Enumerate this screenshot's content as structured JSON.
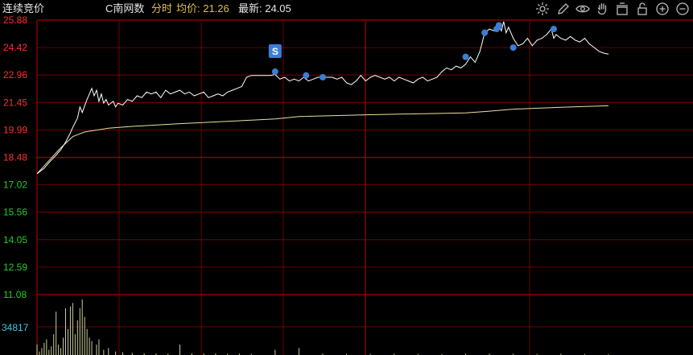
{
  "header": {
    "title": "连续竞价",
    "stock_name": "C南网数",
    "mode": "分时",
    "avg_label": "均价: 21.26",
    "latest_label": "最新: 24.05"
  },
  "toolbar": {
    "icons": [
      "gear-icon",
      "pen-icon",
      "eye-icon",
      "hand-icon",
      "basket-icon",
      "lock-icon",
      "zoom-in-icon",
      "zoom-out-icon"
    ]
  },
  "colors": {
    "price_line": "#ffffff",
    "avg_line": "#e8e2a0",
    "grid_red": "#8b0000",
    "axis_up": "#ff3030",
    "axis_down": "#22cc22",
    "volume": "#cccc99",
    "marker": "#3a7fd5",
    "badge_bg": "#3a7fd5"
  },
  "signal_badge": "S",
  "volume_label": "34817",
  "chart_data": {
    "type": "line",
    "y_ticks": [
      "25.88",
      "24.42",
      "22.96",
      "21.45",
      "19.99",
      "18.48",
      "17.02",
      "15.56",
      "14.05",
      "12.59",
      "11.08"
    ],
    "ylim": [
      11.08,
      25.88
    ],
    "x_range": [
      0,
      240
    ],
    "price": [
      [
        0,
        17.6
      ],
      [
        3,
        17.9
      ],
      [
        5,
        18.2
      ],
      [
        8,
        18.6
      ],
      [
        10,
        18.9
      ],
      [
        12,
        19.3
      ],
      [
        14,
        19.8
      ],
      [
        15,
        20.1
      ],
      [
        17,
        20.6
      ],
      [
        18,
        21.2
      ],
      [
        19,
        20.9
      ],
      [
        21,
        21.6
      ],
      [
        22,
        21.9
      ],
      [
        23,
        22.2
      ],
      [
        24,
        21.8
      ],
      [
        25,
        22.1
      ],
      [
        26,
        21.5
      ],
      [
        27,
        21.9
      ],
      [
        28,
        21.4
      ],
      [
        29,
        21.6
      ],
      [
        30,
        21.3
      ],
      [
        32,
        21.5
      ],
      [
        33,
        21.2
      ],
      [
        34,
        21.4
      ],
      [
        36,
        21.3
      ],
      [
        38,
        21.6
      ],
      [
        40,
        21.5
      ],
      [
        42,
        21.8
      ],
      [
        44,
        21.7
      ],
      [
        46,
        22.0
      ],
      [
        48,
        21.9
      ],
      [
        50,
        22.0
      ],
      [
        52,
        21.7
      ],
      [
        54,
        22.1
      ],
      [
        56,
        21.9
      ],
      [
        58,
        22.0
      ],
      [
        60,
        22.1
      ],
      [
        62,
        21.9
      ],
      [
        64,
        22.0
      ],
      [
        66,
        21.8
      ],
      [
        68,
        21.9
      ],
      [
        70,
        22.0
      ],
      [
        72,
        21.7
      ],
      [
        74,
        21.8
      ],
      [
        76,
        21.9
      ],
      [
        78,
        21.8
      ],
      [
        80,
        22.0
      ],
      [
        82,
        22.1
      ],
      [
        84,
        22.2
      ],
      [
        86,
        22.3
      ],
      [
        88,
        22.8
      ],
      [
        90,
        22.9
      ],
      [
        92,
        22.9
      ],
      [
        94,
        22.9
      ],
      [
        96,
        22.9
      ],
      [
        98,
        22.9
      ],
      [
        100,
        22.95
      ],
      [
        102,
        22.7
      ],
      [
        104,
        22.8
      ],
      [
        106,
        22.6
      ],
      [
        108,
        22.7
      ],
      [
        110,
        22.6
      ],
      [
        112,
        22.8
      ],
      [
        114,
        22.6
      ],
      [
        116,
        22.7
      ],
      [
        118,
        22.8
      ],
      [
        120,
        22.8
      ],
      [
        122,
        22.8
      ],
      [
        124,
        22.8
      ],
      [
        126,
        22.7
      ],
      [
        128,
        22.8
      ],
      [
        130,
        22.5
      ],
      [
        132,
        22.4
      ],
      [
        134,
        22.6
      ],
      [
        136,
        22.9
      ],
      [
        138,
        22.6
      ],
      [
        140,
        22.8
      ],
      [
        142,
        22.9
      ],
      [
        144,
        22.8
      ],
      [
        146,
        22.7
      ],
      [
        148,
        22.8
      ],
      [
        150,
        22.6
      ],
      [
        152,
        22.8
      ],
      [
        154,
        22.7
      ],
      [
        156,
        22.6
      ],
      [
        158,
        22.5
      ],
      [
        160,
        22.7
      ],
      [
        162,
        22.8
      ],
      [
        164,
        22.6
      ],
      [
        166,
        22.7
      ],
      [
        168,
        22.8
      ],
      [
        170,
        23.1
      ],
      [
        172,
        23.3
      ],
      [
        174,
        23.2
      ],
      [
        176,
        23.4
      ],
      [
        178,
        23.3
      ],
      [
        180,
        23.5
      ],
      [
        182,
        23.9
      ],
      [
        184,
        23.6
      ],
      [
        186,
        24.2
      ],
      [
        188,
        25.2
      ],
      [
        190,
        25.4
      ],
      [
        192,
        25.3
      ],
      [
        194,
        25.6
      ],
      [
        195,
        25.3
      ],
      [
        196,
        25.8
      ],
      [
        197,
        25.2
      ],
      [
        198,
        25.5
      ],
      [
        200,
        24.9
      ],
      [
        202,
        24.5
      ],
      [
        204,
        24.6
      ],
      [
        206,
        24.9
      ],
      [
        208,
        24.5
      ],
      [
        210,
        24.8
      ],
      [
        212,
        24.9
      ],
      [
        214,
        25.1
      ],
      [
        216,
        25.4
      ],
      [
        217,
        24.9
      ],
      [
        218,
        25.1
      ],
      [
        220,
        24.9
      ],
      [
        222,
        24.8
      ],
      [
        224,
        25.0
      ],
      [
        226,
        24.8
      ],
      [
        228,
        24.7
      ],
      [
        230,
        24.9
      ],
      [
        232,
        24.6
      ],
      [
        234,
        24.4
      ],
      [
        236,
        24.2
      ],
      [
        238,
        24.1
      ],
      [
        240,
        24.05
      ]
    ],
    "average": [
      [
        0,
        17.6
      ],
      [
        5,
        18.3
      ],
      [
        10,
        19.0
      ],
      [
        15,
        19.6
      ],
      [
        20,
        19.85
      ],
      [
        30,
        20.05
      ],
      [
        40,
        20.15
      ],
      [
        60,
        20.3
      ],
      [
        80,
        20.42
      ],
      [
        100,
        20.55
      ],
      [
        110,
        20.68
      ],
      [
        140,
        20.78
      ],
      [
        180,
        20.88
      ],
      [
        190,
        20.97
      ],
      [
        200,
        21.08
      ],
      [
        220,
        21.18
      ],
      [
        240,
        21.26
      ]
    ],
    "buy_markers": [
      [
        100,
        23.1
      ],
      [
        113,
        22.9
      ],
      [
        120,
        22.8
      ],
      [
        180,
        23.9
      ],
      [
        188,
        25.2
      ],
      [
        193,
        25.4
      ],
      [
        194,
        25.6
      ],
      [
        200,
        24.4
      ],
      [
        217,
        25.4
      ]
    ],
    "signal_x": 100,
    "volume_max": 34817,
    "volume": [
      [
        0,
        6000
      ],
      [
        1,
        2000
      ],
      [
        2,
        4000
      ],
      [
        3,
        7000
      ],
      [
        4,
        9000
      ],
      [
        5,
        3000
      ],
      [
        6,
        5000
      ],
      [
        7,
        12000
      ],
      [
        8,
        25000
      ],
      [
        9,
        6000
      ],
      [
        10,
        4000
      ],
      [
        11,
        10000
      ],
      [
        12,
        27000
      ],
      [
        13,
        15000
      ],
      [
        14,
        28000
      ],
      [
        15,
        30000
      ],
      [
        16,
        12000
      ],
      [
        17,
        20000
      ],
      [
        18,
        27000
      ],
      [
        19,
        32000
      ],
      [
        20,
        22000
      ],
      [
        21,
        15000
      ],
      [
        22,
        10000
      ],
      [
        23,
        8000
      ],
      [
        25,
        6000
      ],
      [
        26,
        9000
      ],
      [
        28,
        3000
      ],
      [
        30,
        4000
      ],
      [
        33,
        2000
      ],
      [
        36,
        1500
      ],
      [
        40,
        1200
      ],
      [
        45,
        1000
      ],
      [
        50,
        900
      ],
      [
        55,
        800
      ],
      [
        60,
        6000
      ],
      [
        65,
        1000
      ],
      [
        70,
        800
      ],
      [
        75,
        900
      ],
      [
        80,
        700
      ],
      [
        85,
        800
      ],
      [
        90,
        700
      ],
      [
        100,
        3000
      ],
      [
        110,
        4000
      ],
      [
        120,
        800
      ],
      [
        130,
        700
      ],
      [
        140,
        600
      ],
      [
        150,
        700
      ],
      [
        160,
        600
      ],
      [
        170,
        500
      ],
      [
        180,
        700
      ],
      [
        190,
        800
      ],
      [
        200,
        700
      ],
      [
        210,
        600
      ],
      [
        220,
        700
      ],
      [
        230,
        600
      ],
      [
        240,
        500
      ]
    ]
  }
}
